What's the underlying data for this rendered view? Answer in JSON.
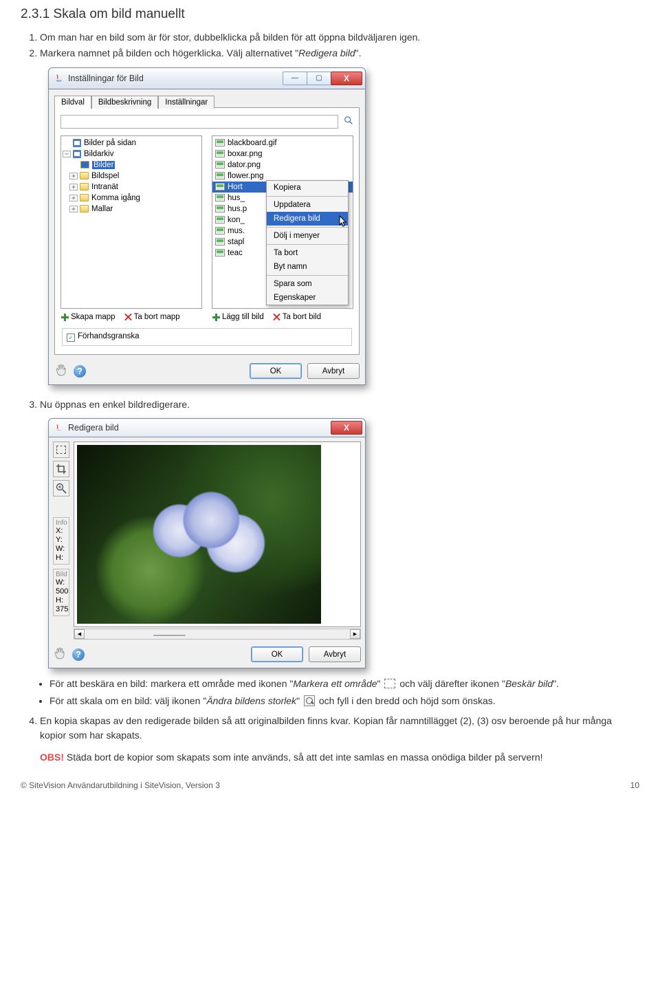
{
  "doc": {
    "heading": "2.3.1 Skala om bild manuellt",
    "step1": "Om man har en bild som är för stor, dubbelklicka på bilden för att öppna bildväljaren igen.",
    "step2_a": "Markera namnet på bilden och högerklicka. Välj alternativet \"",
    "step2_b": "Redigera bild",
    "step2_c": "\".",
    "step3": "Nu öppnas en enkel bildredigerare.",
    "bullet1_a": "För att beskära en bild: markera ett område med ikonen \"",
    "bullet1_b": "Markera ett område",
    "bullet1_c": "\"       och välj därefter ikonen \"",
    "bullet1_d": "Beskär bild",
    "bullet1_e": "\".",
    "bullet2_a": "För att skala om en bild: välj ikonen \"",
    "bullet2_b": "Ändra bildens storlek",
    "bullet2_c": "\"      och fyll i den bredd och höjd som önskas.",
    "step4": "En kopia skapas av den redigerade bilden så att originalbilden finns kvar. Kopian får namntillägget (2), (3) osv beroende på hur många kopior som har skapats.",
    "obs_label": "OBS!",
    "obs_text": " Städa bort de kopior som skapats som inte används, så att det inte samlas en massa onödiga bilder på servern!",
    "footer_left": "© SiteVision Användarutbildning i SiteVision, Version 3",
    "footer_right": "10"
  },
  "dialog1": {
    "title": "Inställningar för Bild",
    "sys_min": "—",
    "sys_max": "▢",
    "sys_close": "X",
    "tabs": [
      "Bildval",
      "Bildbeskrivning",
      "Inställningar"
    ],
    "tree": {
      "root1": "Bilder på sidan",
      "root2": "Bildarkiv",
      "bilder": "Bilder",
      "bildspel": "Bildspel",
      "intranat": "Intranät",
      "komma": "Komma igång",
      "mallar": "Mallar"
    },
    "files": [
      "blackboard.gif",
      "boxar.png",
      "dator.png",
      "flower.png",
      "Hort",
      "hus_",
      "hus.p",
      "kon_",
      "mus.",
      "stapl",
      "teac"
    ],
    "file_sel_index": 4,
    "context_menu": {
      "kopiera": "Kopiera",
      "uppdatera": "Uppdatera",
      "redigera": "Redigera bild",
      "dolj": "Dölj i menyer",
      "tabort": "Ta bort",
      "bytnamn": "Byt namn",
      "sparasom": "Spara som",
      "egenskaper": "Egenskaper"
    },
    "actions": {
      "skapa_mapp": "Skapa mapp",
      "ta_bort_mapp": "Ta bort mapp",
      "lagg_till_bild": "Lägg till bild",
      "ta_bort_bild": "Ta bort bild"
    },
    "preview": "Förhandsgranska",
    "ok": "OK",
    "cancel": "Avbryt"
  },
  "dialog2": {
    "title": "Redigera bild",
    "sys_close": "X",
    "info_label": "Info",
    "x": "X:",
    "y": "Y:",
    "w": "W:",
    "h": "H:",
    "bild_label": "Bild",
    "bw": "W: 500",
    "bh": "H: 375",
    "ok": "OK",
    "cancel": "Avbryt"
  }
}
